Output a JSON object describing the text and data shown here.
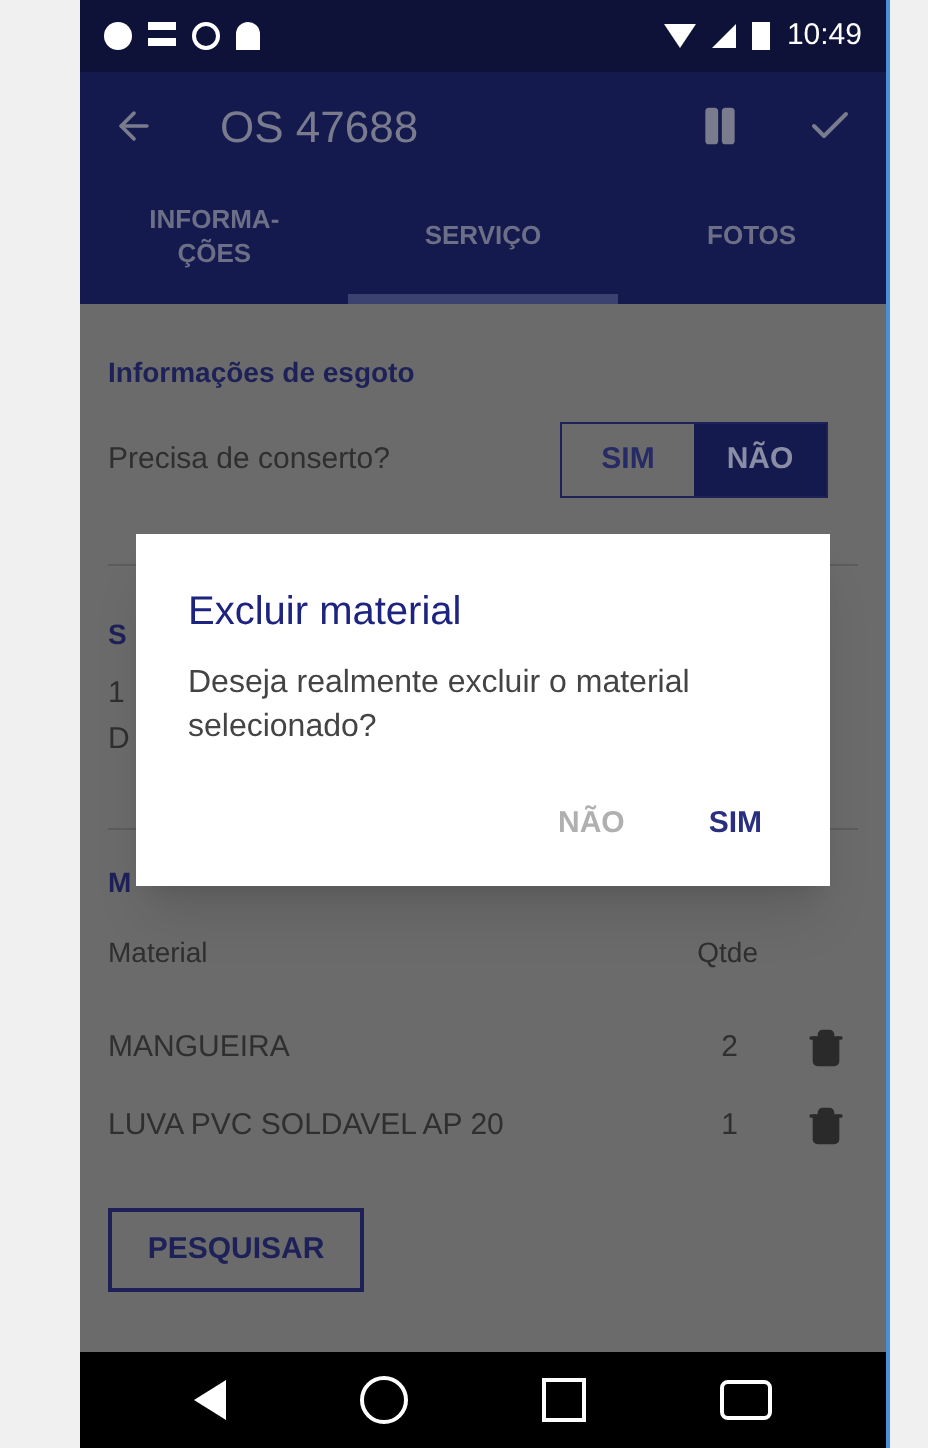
{
  "status_bar": {
    "time": "10:49"
  },
  "toolbar": {
    "title": "OS 47688"
  },
  "tabs": [
    {
      "label": "INFORMA-\nÇÕES",
      "selected": false
    },
    {
      "label": "SERVIÇO",
      "selected": true
    },
    {
      "label": "FOTOS",
      "selected": false
    }
  ],
  "sewer_section": {
    "title": "Informações de esgoto",
    "question": "Precisa de conserto?",
    "options": [
      {
        "label": "SIM",
        "selected": false
      },
      {
        "label": "NÃO",
        "selected": true
      }
    ]
  },
  "hidden_section": {
    "title": "S",
    "row_lines": [
      "1",
      "D"
    ]
  },
  "materials_section": {
    "title": "M",
    "columns": [
      "Material",
      "Qtde"
    ],
    "rows": [
      {
        "material": "MANGUEIRA",
        "qty": "2"
      },
      {
        "material": "LUVA PVC SOLDAVEL AP 20",
        "qty": "1"
      }
    ],
    "search_button": "PESQUISAR"
  },
  "dialog": {
    "title": "Excluir material",
    "message": "Deseja realmente excluir o material selecionado?",
    "buttons": [
      {
        "label": "NÃO",
        "kind": "secondary"
      },
      {
        "label": "SIM",
        "kind": "primary"
      }
    ]
  }
}
